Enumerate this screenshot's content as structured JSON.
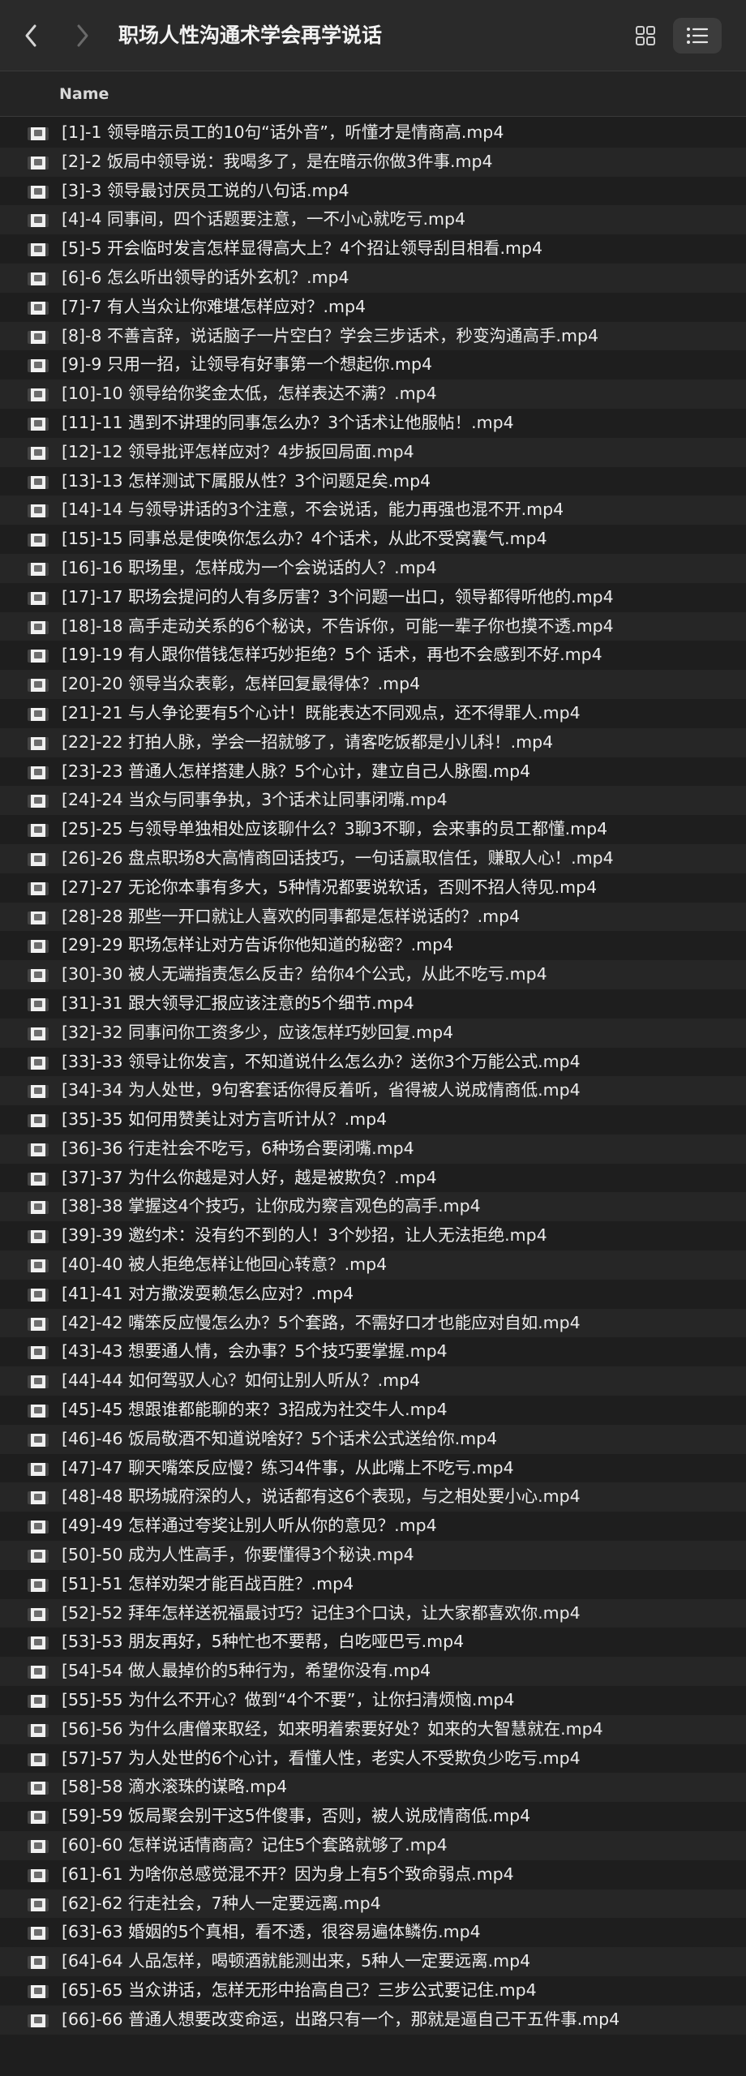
{
  "window": {
    "title": "职场人性沟通术学会再学说话",
    "icons": {
      "back": "chevron-left-icon",
      "forward": "chevron-right-icon",
      "grid_view": "grid-view-icon",
      "list_view": "list-view-icon",
      "file": "video-file-icon"
    },
    "colors": {
      "background": "#1e1e1e",
      "row_alt": "#262626",
      "toolbar": "#2a2a2a",
      "text": "#ececec"
    }
  },
  "columns": {
    "name": "Name"
  },
  "files": [
    "[1]-1 领导暗示员工的10句“话外音”，听懂才是情商高.mp4",
    "[2]-2 饭局中领导说：我喝多了，是在暗示你做3件事.mp4",
    "[3]-3 领导最讨厌员工说的八句话.mp4",
    "[4]-4 同事间，四个话题要注意，一不小心就吃亏.mp4",
    "[5]-5 开会临时发言怎样显得高大上？4个招让领导刮目相看.mp4",
    "[6]-6 怎么听出领导的话外玄机？.mp4",
    "[7]-7 有人当众让你难堪怎样应对？.mp4",
    "[8]-8 不善言辞，说话脑子一片空白？学会三步话术，秒变沟通高手.mp4",
    "[9]-9 只用一招，让领导有好事第一个想起你.mp4",
    "[10]-10 领导给你奖金太低，怎样表达不满？.mp4",
    "[11]-11 遇到不讲理的同事怎么办？3个话术让他服帖！.mp4",
    "[12]-12 领导批评怎样应对？4步扳回局面.mp4",
    "[13]-13 怎样测试下属服从性？3个问题足矣.mp4",
    "[14]-14 与领导讲话的3个注意，不会说话，能力再强也混不开.mp4",
    "[15]-15 同事总是使唤你怎么办？4个话术，从此不受窝囊气.mp4",
    "[16]-16 职场里，怎样成为一个会说话的人？.mp4",
    "[17]-17 职场会提问的人有多厉害？3个问题一出口，领导都得听他的.mp4",
    "[18]-18 高手走动关系的6个秘诀，不告诉你，可能一辈子你也摸不透.mp4",
    "[19]-19 有人跟你借钱怎样巧妙拒绝？5个 话术，再也不会感到不好.mp4",
    "[20]-20 领导当众表彰，怎样回复最得体？.mp4",
    "[21]-21 与人争论要有5个心计！既能表达不同观点，还不得罪人.mp4",
    "[22]-22 打拍人脉，学会一招就够了，请客吃饭都是小儿科！.mp4",
    "[23]-23 普通人怎样搭建人脉？5个心计，建立自己人脉圈.mp4",
    "[24]-24 当众与同事争执，3个话术让同事闭嘴.mp4",
    "[25]-25 与领导单独相处应该聊什么？3聊3不聊，会来事的员工都懂.mp4",
    "[26]-26 盘点职场8大高情商回话技巧，一句话赢取信任，赚取人心！.mp4",
    "[27]-27 无论你本事有多大，5种情况都要说软话，否则不招人待见.mp4",
    "[28]-28 那些一开口就让人喜欢的同事都是怎样说话的？.mp4",
    "[29]-29 职场怎样让对方告诉你他知道的秘密？.mp4",
    "[30]-30 被人无端指责怎么反击？给你4个公式，从此不吃亏.mp4",
    "[31]-31 跟大领导汇报应该注意的5个细节.mp4",
    "[32]-32 同事问你工资多少，应该怎样巧妙回复.mp4",
    "[33]-33 领导让你发言，不知道说什么怎么办？送你3个万能公式.mp4",
    "[34]-34 为人处世，9句客套话你得反着听，省得被人说成情商低.mp4",
    "[35]-35 如何用赞美让对方言听计从？.mp4",
    "[36]-36 行走社会不吃亏，6种场合要闭嘴.mp4",
    "[37]-37 为什么你越是对人好，越是被欺负？.mp4",
    "[38]-38 掌握这4个技巧，让你成为察言观色的高手.mp4",
    "[39]-39 邀约术：没有约不到的人！3个妙招，让人无法拒绝.mp4",
    "[40]-40 被人拒绝怎样让他回心转意？.mp4",
    "[41]-41 对方撒泼耍赖怎么应对？.mp4",
    "[42]-42 嘴笨反应慢怎么办？5个套路，不需好口才也能应对自如.mp4",
    "[43]-43 想要通人情，会办事？5个技巧要掌握.mp4",
    "[44]-44 如何驾驭人心？如何让别人听从？.mp4",
    "[45]-45 想跟谁都能聊的来？3招成为社交牛人.mp4",
    "[46]-46 饭局敬酒不知道说啥好？5个话术公式送给你.mp4",
    "[47]-47 聊天嘴笨反应慢？练习4件事，从此嘴上不吃亏.mp4",
    "[48]-48 职场城府深的人，说话都有这6个表现，与之相处要小心.mp4",
    "[49]-49 怎样通过夸奖让别人听从你的意见？.mp4",
    "[50]-50 成为人性高手，你要懂得3个秘诀.mp4",
    "[51]-51 怎样劝架才能百战百胜？.mp4",
    "[52]-52 拜年怎样送祝福最讨巧？记住3个口诀，让大家都喜欢你.mp4",
    "[53]-53 朋友再好，5种忙也不要帮，白吃哑巴亏.mp4",
    "[54]-54 做人最掉价的5种行为，希望你没有.mp4",
    "[55]-55 为什么不开心？做到“4个不要”，让你扫清烦恼.mp4",
    "[56]-56 为什么唐僧来取经，如来明着索要好处？如来的大智慧就在.mp4",
    "[57]-57 为人处世的6个心计，看懂人性，老实人不受欺负少吃亏.mp4",
    "[58]-58 滴水滚珠的谋略.mp4",
    "[59]-59 饭局聚会别干这5件傻事，否则，被人说成情商低.mp4",
    "[60]-60 怎样说话情商高？记住5个套路就够了.mp4",
    "[61]-61 为啥你总感觉混不开？因为身上有5个致命弱点.mp4",
    "[62]-62 行走社会，7种人一定要远离.mp4",
    "[63]-63 婚姻的5个真相，看不透，很容易遍体鳞伤.mp4",
    "[64]-64 人品怎样，喝顿酒就能测出来，5种人一定要远离.mp4",
    "[65]-65 当众讲话，怎样无形中抬高自己？三步公式要记住.mp4",
    "[66]-66 普通人想要改变命运，出路只有一个，那就是逼自己干五件事.mp4"
  ]
}
